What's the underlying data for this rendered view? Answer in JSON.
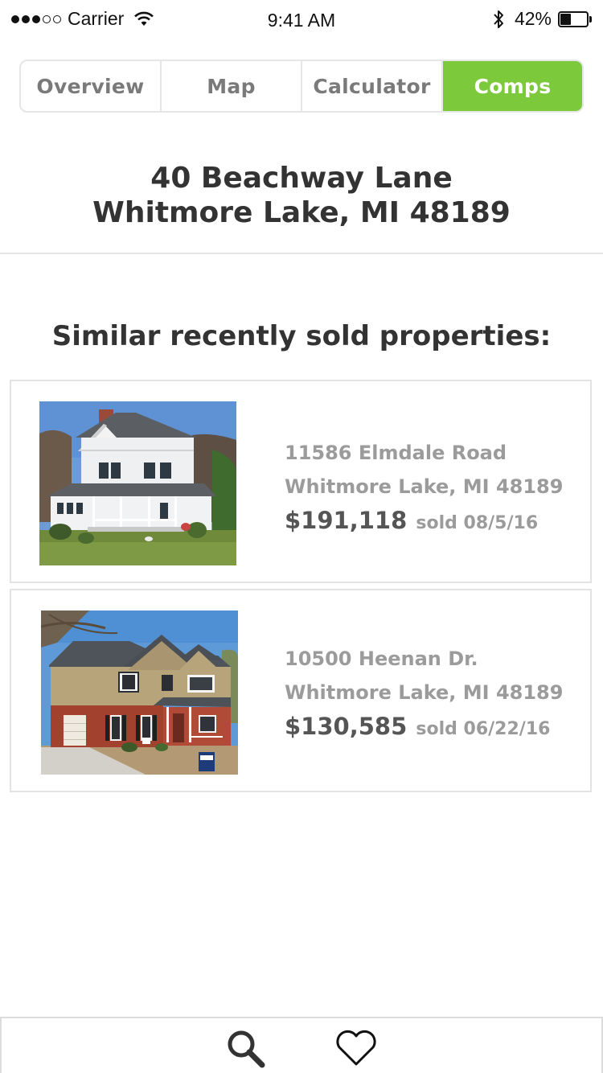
{
  "status_bar": {
    "carrier": "Carrier",
    "time": "9:41 AM",
    "battery_text": "42%",
    "battery_level": 0.42,
    "signal_filled": 3,
    "signal_total": 5
  },
  "tabs": [
    {
      "label": "Overview",
      "active": false
    },
    {
      "label": "Map",
      "active": false
    },
    {
      "label": "Calculator",
      "active": false
    },
    {
      "label": "Comps",
      "active": true
    }
  ],
  "property": {
    "street": "40 Beachway Lane",
    "city_line": "Whitmore Lake, MI 48189"
  },
  "section_title": "Similar recently sold properties:",
  "comps": [
    {
      "street": "11586 Elmdale Road",
      "city_line": "Whitmore Lake, MI 48189",
      "price": "$191,118",
      "sold": "sold 08/5/16",
      "photo": "white-farmhouse-photo"
    },
    {
      "street": "10500 Heenan Dr.",
      "city_line": "Whitmore Lake, MI 48189",
      "price": "$130,585",
      "sold": "sold 06/22/16",
      "photo": "brick-two-story-house-photo"
    }
  ],
  "bottom_nav": {
    "search_icon": "search-icon",
    "favorites_icon": "heart-icon"
  },
  "colors": {
    "accent": "#7cc93b",
    "text_dark": "#333333",
    "text_muted": "#9b9b9b",
    "border": "#e6e6e6"
  }
}
